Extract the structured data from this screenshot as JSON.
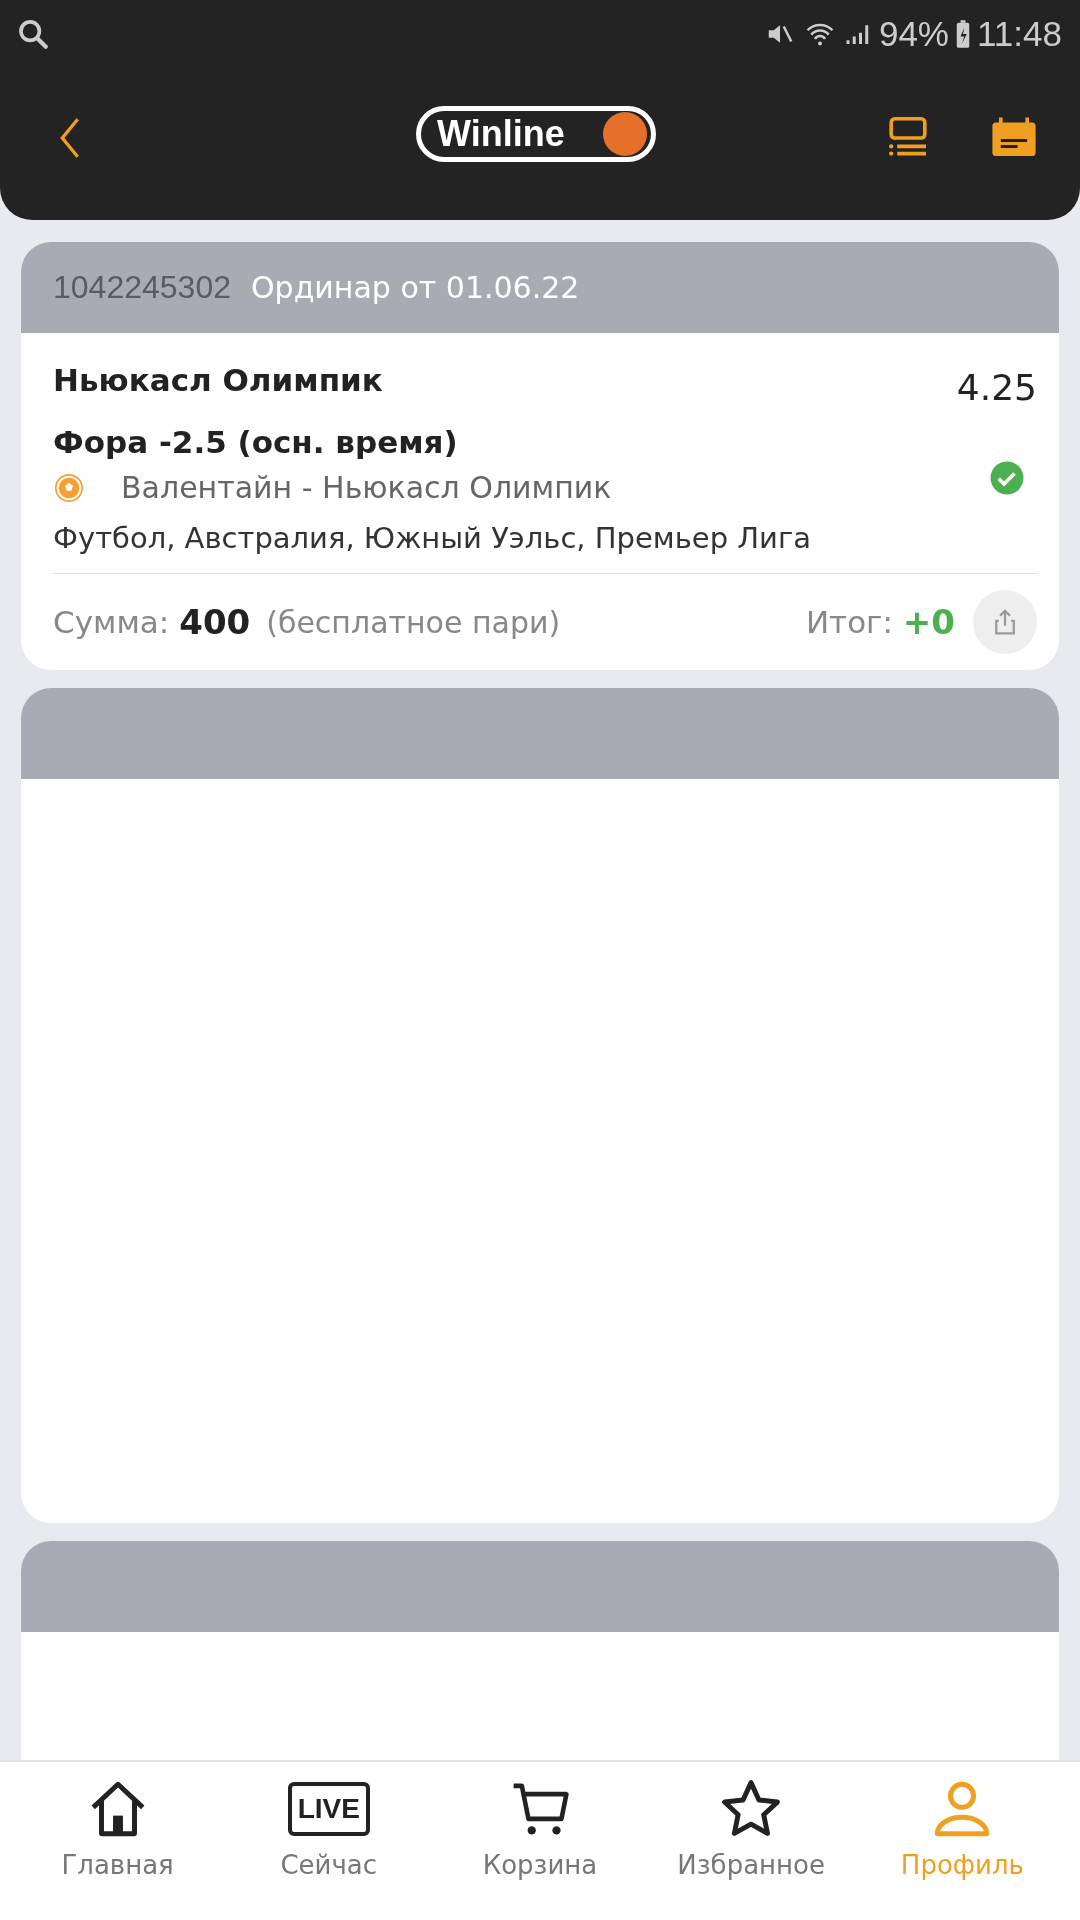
{
  "status_bar": {
    "battery": "94%",
    "time": "11:48"
  },
  "app_bar": {
    "logo": "Winline"
  },
  "bets": [
    {
      "kind": "bet",
      "number": "1042245302",
      "title": "Ординар от 01.06.22",
      "selection": "Ньюкасл Олимпик",
      "odds": "4.25",
      "market": "Фора -2.5 (осн. время)",
      "event": "Валентайн - Ньюкасл Олимпик",
      "won": true,
      "league": "Футбол, Австралия, Южный Уэльс, Премьер Лига",
      "sum_label": "Сумма:",
      "sum": "400",
      "note": "(бесплатное пари)",
      "result_label": "Итог:",
      "result": "+0"
    },
    {
      "kind": "hidden"
    },
    {
      "kind": "hidden"
    }
  ],
  "nav": [
    {
      "kind": "home",
      "label": "Главная",
      "selected": false
    },
    {
      "kind": "live",
      "icon_text": "LIVE",
      "label": "Сейчас",
      "selected": false
    },
    {
      "kind": "cart",
      "label": "Корзина",
      "selected": false
    },
    {
      "kind": "star",
      "label": "Избранное",
      "selected": false
    },
    {
      "kind": "person",
      "label": "Профиль",
      "selected": true
    }
  ]
}
